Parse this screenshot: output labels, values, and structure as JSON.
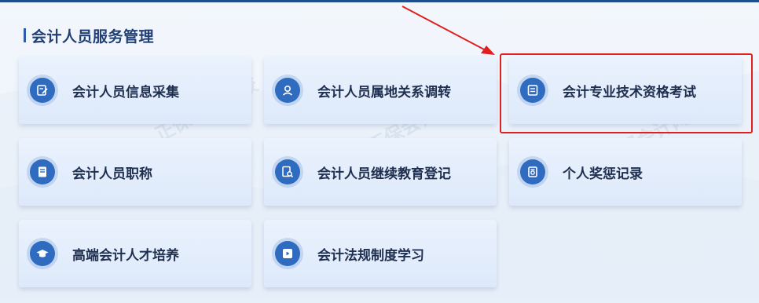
{
  "section": {
    "title": "会计人员服务管理"
  },
  "cards": [
    {
      "label": "会计人员信息采集",
      "icon": "edit-form-icon"
    },
    {
      "label": "会计人员属地关系调转",
      "icon": "person-location-icon"
    },
    {
      "label": "会计专业技术资格考试",
      "icon": "exam-document-icon"
    },
    {
      "label": "会计人员职称",
      "icon": "title-document-icon"
    },
    {
      "label": "会计人员继续教育登记",
      "icon": "education-search-icon"
    },
    {
      "label": "个人奖惩记录",
      "icon": "reward-record-icon"
    },
    {
      "label": "高端会计人才培养",
      "icon": "graduation-cap-icon"
    },
    {
      "label": "会计法规制度学习",
      "icon": "video-play-icon"
    }
  ],
  "watermark": {
    "text": "正保会计网校",
    "subtext": "chinaacc.com"
  },
  "colors": {
    "accent": "#2f6cc0",
    "highlight": "#e02020",
    "title": "#1f3f75"
  }
}
